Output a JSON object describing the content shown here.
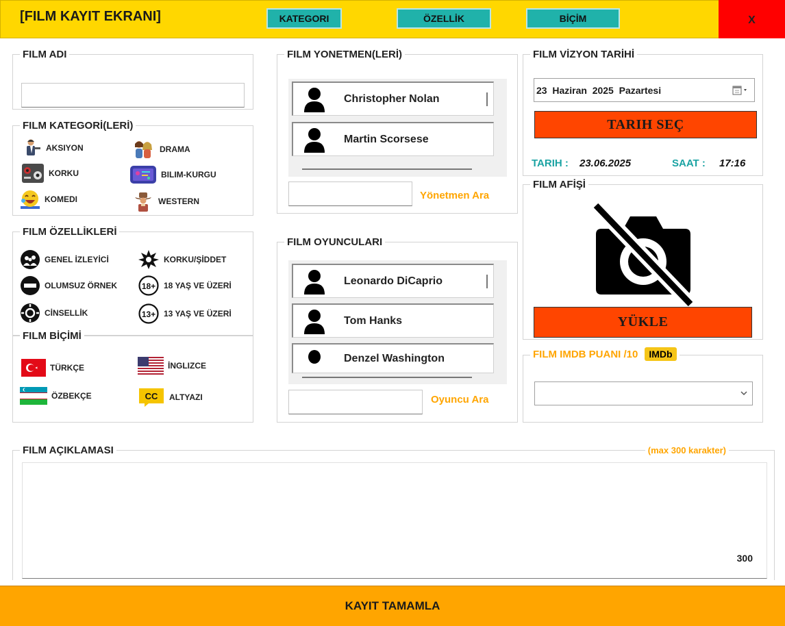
{
  "header": {
    "title": "[FILM KAYIT EKRANI]",
    "nav": [
      "KATEGORI",
      "ÖZELLİK",
      "BİÇİM"
    ],
    "close": "X"
  },
  "film_name": {
    "label": "FILM ADI",
    "value": ""
  },
  "categories": {
    "label": "FILM KATEGORİ(LERİ)",
    "items": [
      {
        "label": "AKSIYON",
        "icon": "action-man-icon"
      },
      {
        "label": "DRAMA",
        "icon": "drama-couple-icon"
      },
      {
        "label": "KORKU",
        "icon": "horror-icon"
      },
      {
        "label": "BILIM-KURGU",
        "icon": "scifi-icon"
      },
      {
        "label": "KOMEDI",
        "icon": "laughing-face-icon"
      },
      {
        "label": "WESTERN",
        "icon": "cowboy-icon"
      }
    ]
  },
  "features": {
    "label": "FILM ÖZELLİKLERİ",
    "items": [
      {
        "label": "GENEL İZLEYİCİ",
        "icon": "general-audience-icon"
      },
      {
        "label": "KORKU/ŞİDDET",
        "icon": "violence-icon"
      },
      {
        "label": "OLUMSUZ ÖRNEK",
        "icon": "no-entry-icon"
      },
      {
        "label": "18 YAŞ VE ÜZERİ",
        "icon": "age-18-icon",
        "badge": "18+"
      },
      {
        "label": "CİNSELLİK",
        "icon": "sexuality-icon"
      },
      {
        "label": "13 YAŞ VE ÜZERİ",
        "icon": "age-13-icon",
        "badge": "13+"
      }
    ]
  },
  "format": {
    "label": "FILM BİÇİMİ",
    "items": [
      {
        "label": "TÜRKÇE",
        "icon": "turkey-flag-icon"
      },
      {
        "label": "İNGLIZCE",
        "icon": "usa-flag-icon"
      },
      {
        "label": "ÖZBEKÇE",
        "icon": "uzbekistan-flag-icon"
      },
      {
        "label": "ALTYAZI",
        "icon": "subtitle-cc-icon",
        "badge": "CC"
      }
    ]
  },
  "directors": {
    "label": "FILM YONETMEN(LERİ)",
    "list": [
      "Christopher Nolan",
      "Martin Scorsese"
    ],
    "search_label": "Yönetmen Ara",
    "search_value": ""
  },
  "actors": {
    "label": "FILM OYUNCULARI",
    "list": [
      "Leonardo DiCaprio",
      "Tom Hanks",
      "Denzel Washington"
    ],
    "search_label": "Oyuncu Ara",
    "search_value": ""
  },
  "release": {
    "label": "FILM VİZYON TARİHİ",
    "date_value": "23  Haziran  2025  Pazartesi",
    "select_button": "TARIH SEÇ",
    "date_label": "TARIH :",
    "date_text": "23.06.2025",
    "time_label": "SAAT :",
    "time_text": "17:16"
  },
  "poster": {
    "label": "FILM AFİŞİ",
    "icon": "no-camera-icon",
    "upload_button": "YÜKLE"
  },
  "imdb": {
    "label": "FILM IMDB PUANI /10",
    "badge": "IMDb",
    "selected": ""
  },
  "description": {
    "label": "FILM AÇIKLAMASI",
    "limit_note": "(max 300 karakter)",
    "value": "",
    "remaining": "300"
  },
  "submit": {
    "label": "KAYIT TAMAMLA"
  },
  "colors": {
    "header": "#FFD700",
    "nav_button": "#20B2AA",
    "close": "#FF0000",
    "action_button": "#FF4500",
    "submit": "#FFA500",
    "accent_teal": "#1AA3A3",
    "accent_orange": "#FFA500"
  }
}
